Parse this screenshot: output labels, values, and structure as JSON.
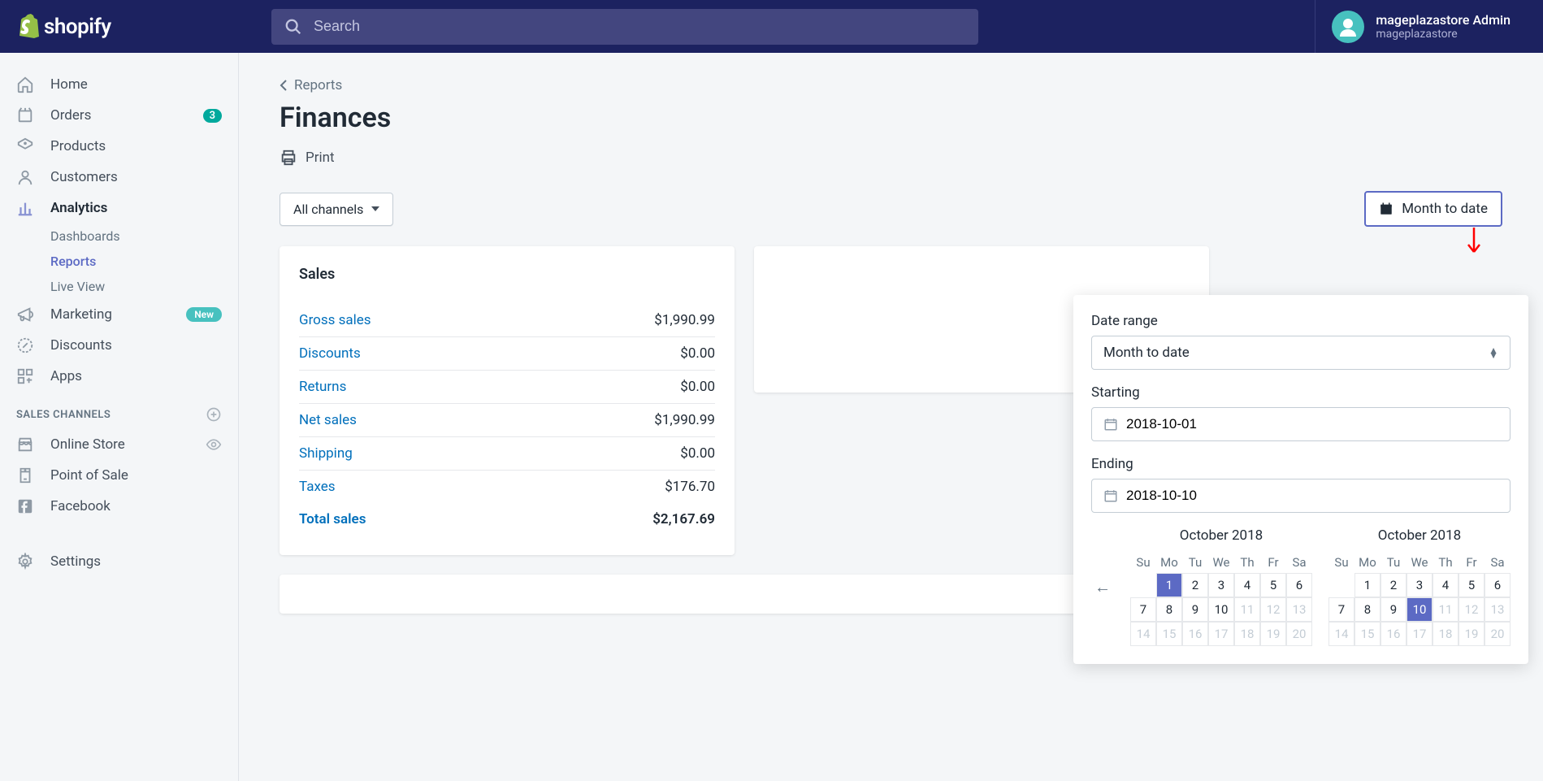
{
  "header": {
    "brand": "shopify",
    "search_placeholder": "Search",
    "user_name": "mageplazastore Admin",
    "store_name": "mageplazastore"
  },
  "sidebar": {
    "items": [
      {
        "label": "Home"
      },
      {
        "label": "Orders",
        "badge": "3"
      },
      {
        "label": "Products"
      },
      {
        "label": "Customers"
      },
      {
        "label": "Analytics",
        "active": true
      },
      {
        "label": "Marketing",
        "new": "New"
      },
      {
        "label": "Discounts"
      },
      {
        "label": "Apps"
      }
    ],
    "analytics_sub": [
      {
        "label": "Dashboards"
      },
      {
        "label": "Reports",
        "active": true
      },
      {
        "label": "Live View"
      }
    ],
    "channels_heading": "SALES CHANNELS",
    "channels": [
      {
        "label": "Online Store"
      },
      {
        "label": "Point of Sale"
      },
      {
        "label": "Facebook"
      }
    ],
    "settings": "Settings"
  },
  "page": {
    "breadcrumb": "Reports",
    "title": "Finances",
    "print": "Print",
    "channels_btn": "All channels",
    "date_btn": "Month to date"
  },
  "sales": {
    "title": "Sales",
    "rows": [
      {
        "label": "Gross sales",
        "value": "$1,990.99"
      },
      {
        "label": "Discounts",
        "value": "$0.00"
      },
      {
        "label": "Returns",
        "value": "$0.00"
      },
      {
        "label": "Net sales",
        "value": "$1,990.99"
      },
      {
        "label": "Shipping",
        "value": "$0.00"
      },
      {
        "label": "Taxes",
        "value": "$176.70"
      }
    ],
    "total_label": "Total sales",
    "total_value": "$2,167.69"
  },
  "date_range": {
    "label": "Date range",
    "preset": "Month to date",
    "starting_label": "Starting",
    "starting": "2018-10-01",
    "ending_label": "Ending",
    "ending": "2018-10-10",
    "month1": "October 2018",
    "month2": "October 2018",
    "dow": [
      "Su",
      "Mo",
      "Tu",
      "We",
      "Th",
      "Fr",
      "Sa"
    ],
    "cal1_selected": 1,
    "cal2_selected": 10,
    "disabled_from": 11,
    "last_day": 20
  }
}
